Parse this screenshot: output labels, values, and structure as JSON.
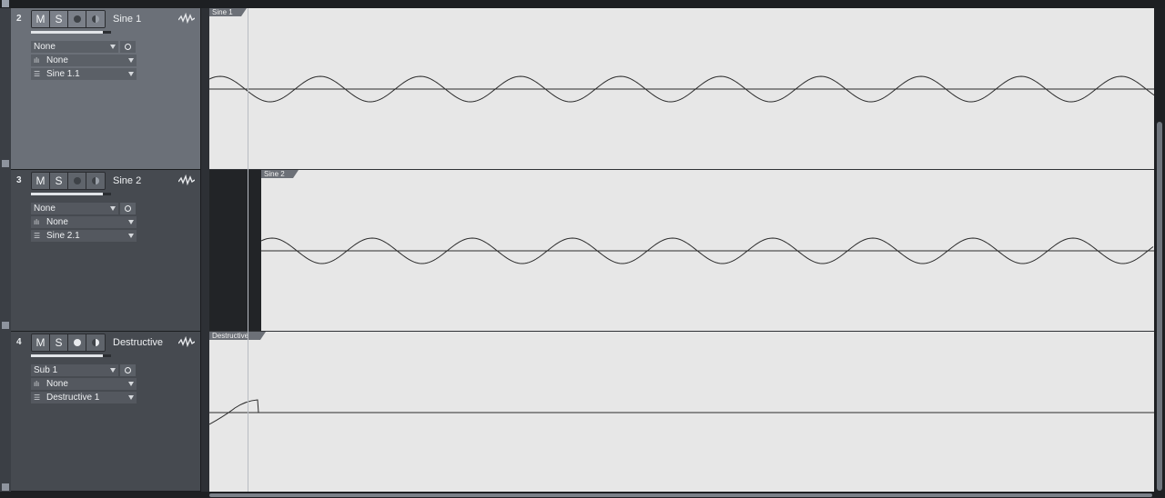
{
  "tracks": [
    {
      "number": "2",
      "buttons": {
        "mute": "M",
        "solo": "S"
      },
      "record_armed": false,
      "monitor_armed": false,
      "name": "Sine 1",
      "fader_level": 0.9,
      "output": "None",
      "instrument": "None",
      "layer": "Sine 1.1",
      "selected": true
    },
    {
      "number": "3",
      "buttons": {
        "mute": "M",
        "solo": "S"
      },
      "record_armed": false,
      "monitor_armed": false,
      "name": "Sine 2",
      "fader_level": 0.9,
      "output": "None",
      "instrument": "None",
      "layer": "Sine 2.1",
      "selected": false
    },
    {
      "number": "4",
      "buttons": {
        "mute": "M",
        "solo": "S"
      },
      "record_armed": true,
      "monitor_armed": true,
      "name": "Destructive",
      "fader_level": 0.9,
      "output": "Sub 1",
      "instrument": "None",
      "layer": "Destructive 1",
      "selected": false
    }
  ],
  "events": [
    {
      "name": "Sine 1"
    },
    {
      "name": "Sine 2"
    },
    {
      "name": "Destructive"
    }
  ],
  "icons": {
    "waveform": "waveform-icon",
    "caret": "chevron-down-icon",
    "monitor_o": "circle-icon",
    "instrument": "bars-icon",
    "layer": "layers-icon"
  },
  "colors": {
    "selected_header": "#6b7078",
    "header": "#464a50",
    "arrange_bg": "#e7e7e7"
  }
}
